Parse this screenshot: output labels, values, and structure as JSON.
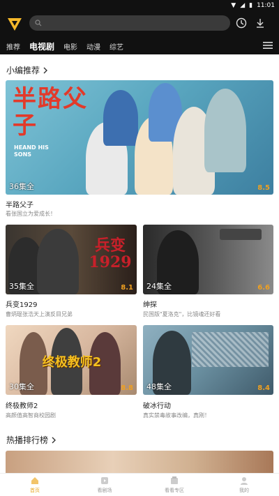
{
  "status_bar": {
    "time": "11:01"
  },
  "header": {
    "search_placeholder": "",
    "tabs": [
      {
        "label": "推荐",
        "active": false
      },
      {
        "label": "电视剧",
        "active": true
      },
      {
        "label": "电影",
        "active": false
      },
      {
        "label": "动漫",
        "active": false
      },
      {
        "label": "综艺",
        "active": false
      }
    ]
  },
  "section_editor": {
    "title": "小编推荐"
  },
  "featured": {
    "episodes": "36集全",
    "score": "8.5",
    "title": "半路父子",
    "desc": "看张国立为爱成长！",
    "poster_text": "半路父子",
    "poster_en": "HEAND HIS SONS"
  },
  "cards": [
    {
      "episodes": "35集全",
      "score": "8.1",
      "title": "兵变1929",
      "desc": "曹炳琨张浩天上演反目兄弟",
      "poster_text": "兵变1929"
    },
    {
      "episodes": "24集全",
      "score": "6.6",
      "title": "绅探",
      "desc": "民国版\"夏洛克\"，比镜魂还好看"
    },
    {
      "episodes": "30集全",
      "score": "8.8",
      "title": "终极教师2",
      "desc": "高颜值高智商校园剧",
      "poster_text": "终极教师2"
    },
    {
      "episodes": "48集全",
      "score": "8.4",
      "title": "破冰行动",
      "desc": "真实禁毒故事改编，真刚！"
    }
  ],
  "section_hot": {
    "title": "热播排行榜"
  },
  "bottom_nav": [
    {
      "label": "首页",
      "icon": "home-icon",
      "active": true
    },
    {
      "label": "看剧场",
      "icon": "theater-icon",
      "active": false
    },
    {
      "label": "看看专区",
      "icon": "zone-icon",
      "active": false
    },
    {
      "label": "我的",
      "icon": "profile-icon",
      "active": false
    }
  ],
  "colors": {
    "accent": "#e8a520",
    "topbar": "#111111",
    "score": "#f0a020"
  }
}
